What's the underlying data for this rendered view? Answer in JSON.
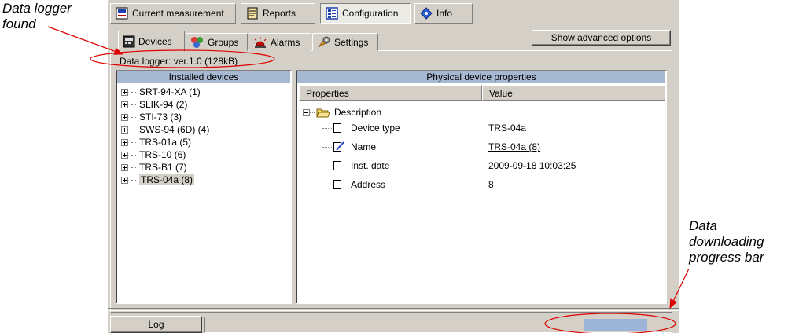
{
  "top_tabs": [
    {
      "label": "Current measurement",
      "icon": "meter-icon"
    },
    {
      "label": "Reports",
      "icon": "report-icon"
    },
    {
      "label": "Configuration",
      "icon": "configuration-icon"
    },
    {
      "label": "Info",
      "icon": "info-icon"
    }
  ],
  "sub_tabs": [
    {
      "label": "Devices",
      "icon": "device-icon"
    },
    {
      "label": "Groups",
      "icon": "groups-icon"
    },
    {
      "label": "Alarms",
      "icon": "alarm-icon"
    },
    {
      "label": "Settings",
      "icon": "settings-icon"
    }
  ],
  "advanced_button": "Show advanced options",
  "logger_status": "Data logger: ver.1.0 (128kB)",
  "installed_devices": {
    "header": "Installed devices",
    "items": [
      "SRT-94-XA (1)",
      "SLIK-94 (2)",
      "STI-73 (3)",
      "SWS-94 (6D) (4)",
      "TRS-01a (5)",
      "TRS-10 (6)",
      "TRS-B1 (7)",
      "TRS-04a (8)"
    ],
    "selected_index": 7
  },
  "properties_panel": {
    "header": "Physical device properties",
    "columns": {
      "properties": "Properties",
      "value": "Value"
    },
    "group": "Description",
    "rows": [
      {
        "name": "Device type",
        "value": "TRS-04a"
      },
      {
        "name": "Name",
        "value": "TRS-04a (8)"
      },
      {
        "name": "Inst. date",
        "value": "2009-09-18 10:03:25"
      },
      {
        "name": "Address",
        "value": "8"
      }
    ]
  },
  "log_button": "Log",
  "progress": {
    "fraction": 1.0
  },
  "annotations": {
    "logger_found": [
      "Data logger",
      "found"
    ],
    "progress_bar": [
      "Data",
      "downloading",
      "progress bar"
    ]
  },
  "colors": {
    "window_bg": "#d4d0c8",
    "panel_header": "#a6b8d2",
    "progress_fill": "#9bb4d8",
    "annotation_red": "#e00000"
  }
}
